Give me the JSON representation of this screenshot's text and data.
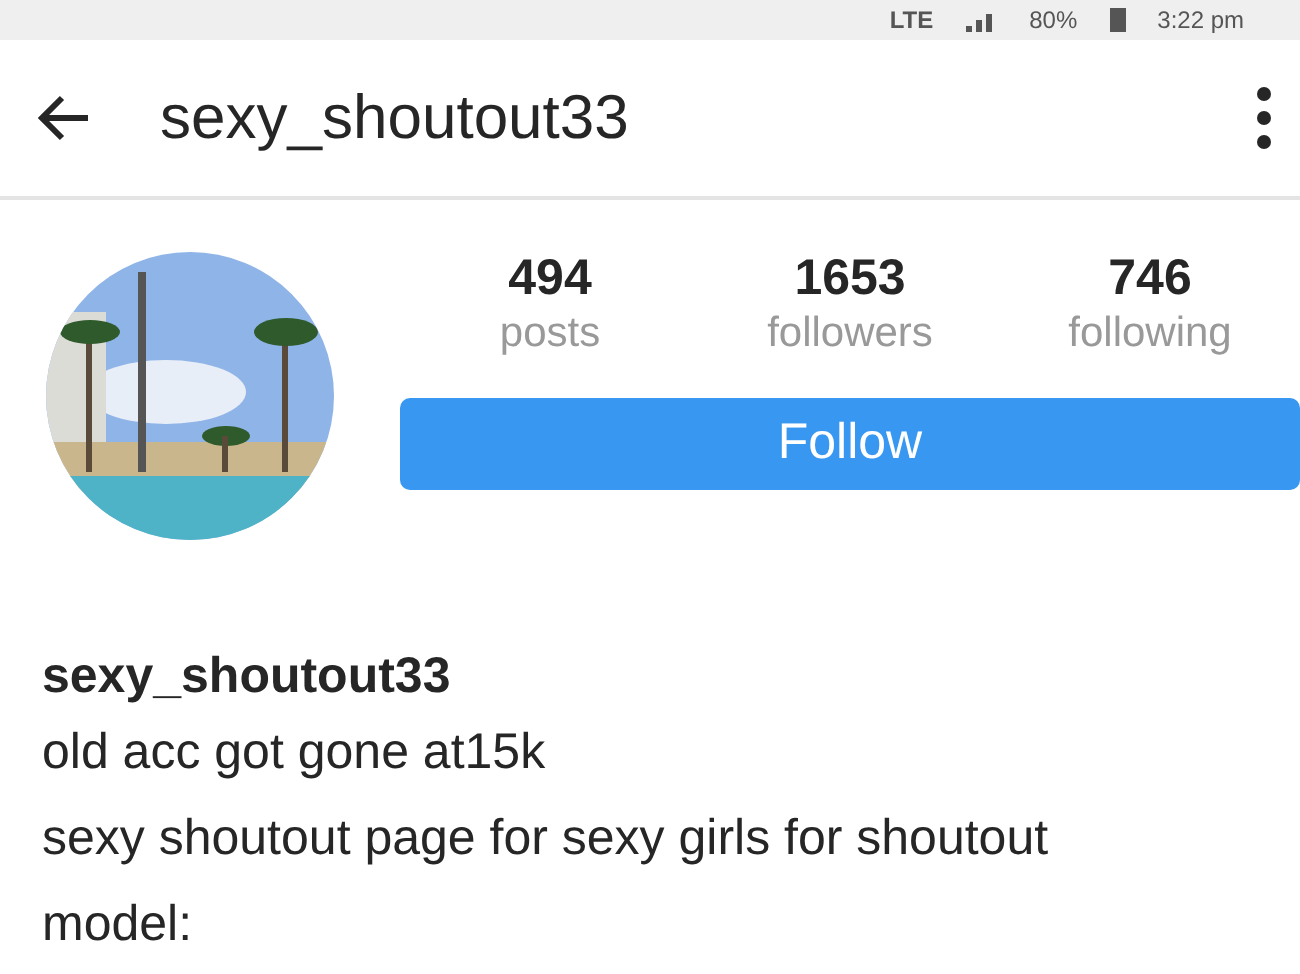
{
  "status_bar": {
    "network": "LTE",
    "battery": "80%",
    "time": "3:22 pm"
  },
  "header": {
    "username": "sexy_shoutout33"
  },
  "profile": {
    "stats": [
      {
        "value": "494",
        "label": "posts"
      },
      {
        "value": "1653",
        "label": "followers"
      },
      {
        "value": "746",
        "label": "following"
      }
    ],
    "follow_button": "Follow"
  },
  "bio": {
    "name": "sexy_shoutout33",
    "lines": [
      "old acc got gone at15k",
      "sexy shoutout page for sexy girls for shoutout",
      "model:"
    ]
  }
}
